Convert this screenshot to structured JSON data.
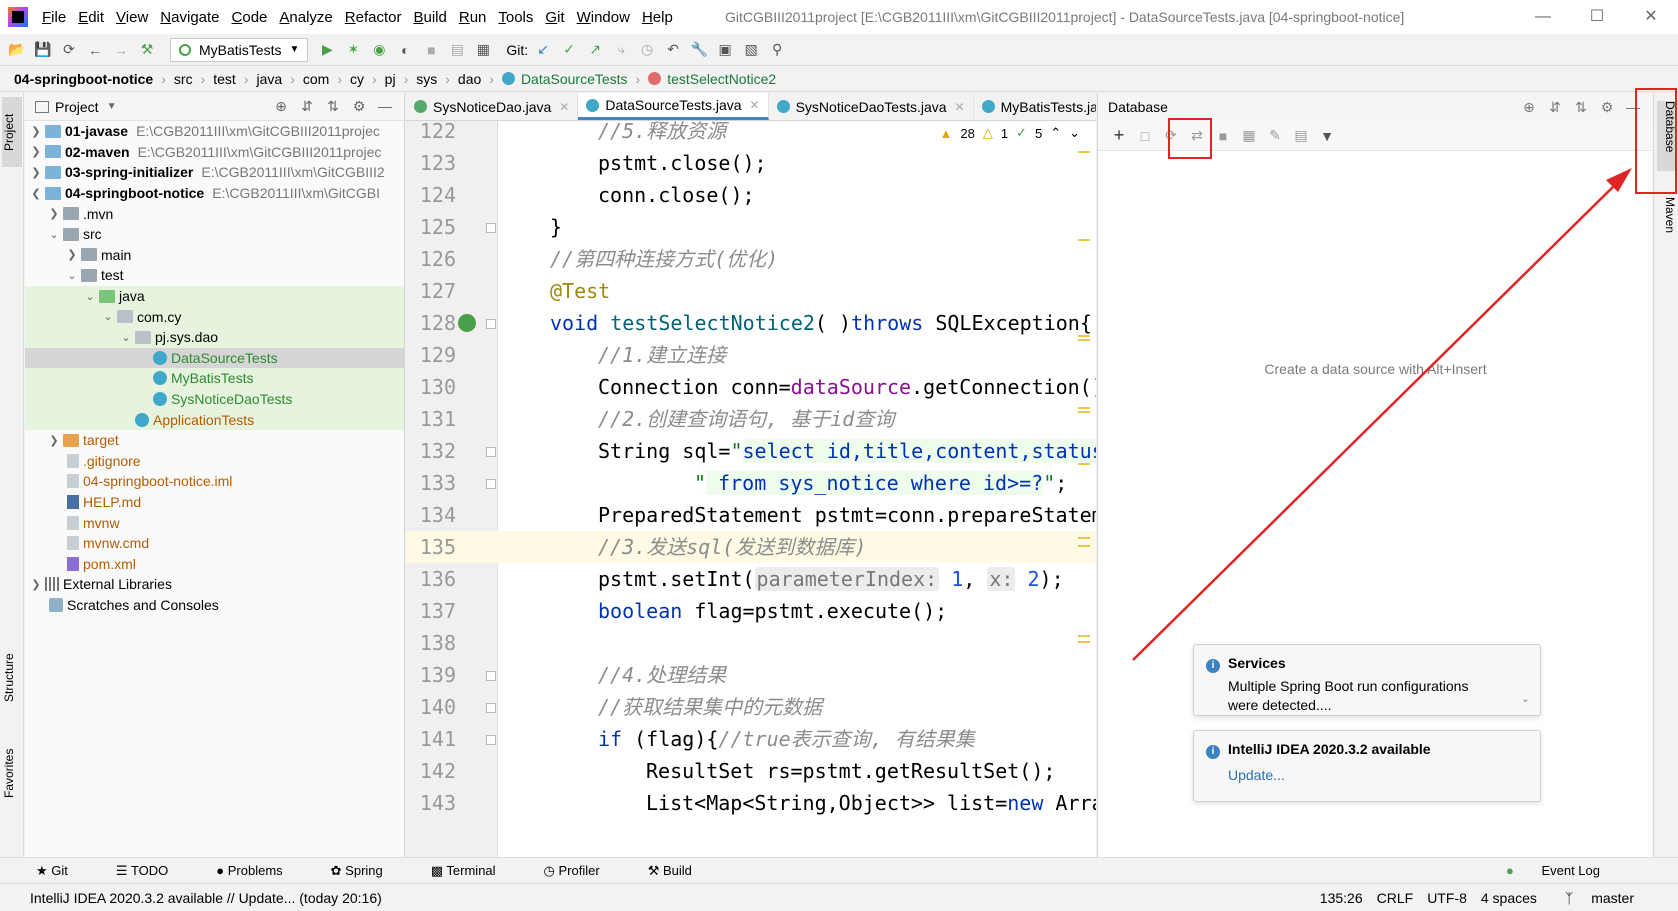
{
  "window": {
    "title": "GitCGBIII2011project [E:\\CGB2011III\\xm\\GitCGBIII2011project] - DataSourceTests.java [04-springboot-notice]",
    "menu": [
      "File",
      "Edit",
      "View",
      "Navigate",
      "Code",
      "Analyze",
      "Refactor",
      "Build",
      "Run",
      "Tools",
      "Git",
      "Window",
      "Help"
    ]
  },
  "toolbar": {
    "run_config": "MyBatisTests",
    "git_label": "Git:"
  },
  "breadcrumb": [
    "04-springboot-notice",
    "src",
    "test",
    "java",
    "com",
    "cy",
    "pj",
    "sys",
    "dao",
    "DataSourceTests",
    "testSelectNotice2"
  ],
  "left_strip": {
    "project": "Project",
    "structure": "Structure",
    "favorites": "Favorites"
  },
  "project_panel": {
    "title": "Project",
    "tree": [
      {
        "label": "01-javase",
        "path": "E:\\CGB2011III\\xm\\GitCGBIII2011projec"
      },
      {
        "label": "02-maven",
        "path": "E:\\CGB2011III\\xm\\GitCGBIII2011projec"
      },
      {
        "label": "03-spring-initializer",
        "path": "E:\\CGB2011III\\xm\\GitCGBIII2"
      },
      {
        "label": "04-springboot-notice",
        "path": "E:\\CGB2011III\\xm\\GitCGBI"
      },
      {
        "label": ".mvn"
      },
      {
        "label": "src"
      },
      {
        "label": "main"
      },
      {
        "label": "test"
      },
      {
        "label": "java"
      },
      {
        "label": "com.cy"
      },
      {
        "label": "pj.sys.dao"
      },
      {
        "label": "DataSourceTests"
      },
      {
        "label": "MyBatisTests"
      },
      {
        "label": "SysNoticeDaoTests"
      },
      {
        "label": "ApplicationTests"
      },
      {
        "label": "target"
      },
      {
        "label": ".gitignore"
      },
      {
        "label": "04-springboot-notice.iml"
      },
      {
        "label": "HELP.md"
      },
      {
        "label": "mvnw"
      },
      {
        "label": "mvnw.cmd"
      },
      {
        "label": "pom.xml"
      },
      {
        "label": "External Libraries"
      },
      {
        "label": "Scratches and Consoles"
      }
    ]
  },
  "editor": {
    "tabs": [
      "SysNoticeDao.java",
      "DataSourceTests.java",
      "SysNoticeDaoTests.java",
      "MyBatisTests.java"
    ],
    "active_tab": "DataSourceTests.java",
    "inspections": {
      "warnings": "28",
      "weak_warnings": "1",
      "ok": "5"
    },
    "lines": [
      "122",
      "123",
      "124",
      "125",
      "126",
      "127",
      "128",
      "129",
      "130",
      "131",
      "132",
      "133",
      "134",
      "135",
      "136",
      "137",
      "138",
      "139",
      "140",
      "141",
      "142",
      "143"
    ],
    "code": {
      "l122": "//5.释放资源",
      "l123": "pstmt.close();",
      "l124": "conn.close();",
      "l125": "}",
      "l126": "//第四种连接方式(优化)",
      "l127": "@Test",
      "l128a": "void ",
      "l128b": "testSelectNotice2",
      "l128c": "( )",
      "l128d": "throws",
      "l128e": " SQLException{",
      "l129": "//1.建立连接",
      "l130a": "Connection conn=",
      "l130b": "dataSource",
      "l130c": ".getConnection();",
      "l131": "//2.创建查询语句, 基于id查询",
      "l132a": "String sql=",
      "l132b": "\"",
      "l132c": "select id,title,content,status,",
      "l133a": "\"",
      "l133b": " from sys_notice where id>=?",
      "l133c": "\"",
      "l133d": ";",
      "l134": "PreparedStatement pstmt=conn.prepareStateme",
      "l135": "//3.发送sql(发送到数据库)",
      "l136a": "pstmt.setInt(",
      "l136b": "parameterIndex:",
      "l136c": "1",
      "l136d": ", ",
      "l136e": "x:",
      "l136f": "2",
      "l136g": ");",
      "l137a": "boolean",
      "l137b": " flag=pstmt.execute();",
      "l139": "//4.处理结果",
      "l140": "//获取结果集中的元数据",
      "l141a": "if",
      "l141b": " (flag){",
      "l141c": "//true表示查询, 有结果集",
      "l142": "ResultSet rs=pstmt.getResultSet();",
      "l143a": "List<Map<String,Object>> list=",
      "l143b": "new",
      "l143c": " Array"
    }
  },
  "database_panel": {
    "title": "Database",
    "empty_text": "Create a data source with Alt+Insert",
    "notifications": [
      {
        "title": "Services",
        "body": "Multiple Spring Boot run configurations were detected...."
      },
      {
        "title": "IntelliJ IDEA 2020.3.2 available",
        "link": "Update..."
      }
    ]
  },
  "right_strip": {
    "database": "Database",
    "maven": "Maven"
  },
  "bottom_tabs": [
    "Git",
    "TODO",
    "Problems",
    "Spring",
    "Terminal",
    "Profiler",
    "Build"
  ],
  "event_log": "Event Log",
  "status": {
    "message": "IntelliJ IDEA 2020.3.2 available // Update... (today 20:16)",
    "position": "135:26",
    "line_sep": "CRLF",
    "encoding": "UTF-8",
    "indent": "4 spaces",
    "branch": "master"
  },
  "colors": {
    "accent": "#4083c9",
    "annotation": "#e02424",
    "keyword": "#0033b3"
  }
}
